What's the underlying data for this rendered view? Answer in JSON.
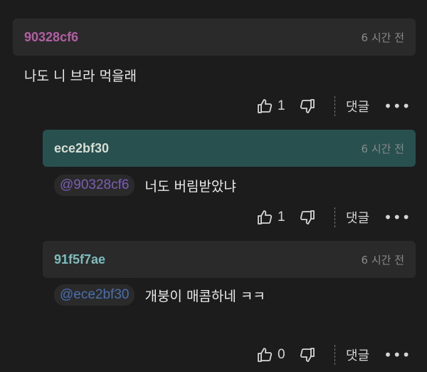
{
  "comments": [
    {
      "author": "90328cf6",
      "author_color": "#b35fa3",
      "time": "6 시간 전",
      "header_bg": "#2a2a2a",
      "text": "나도 니 브라 먹을래",
      "likes": "1"
    },
    {
      "author": "ece2bf30",
      "author_color": "#d7ded3",
      "time": "6 시간 전",
      "header_bg": "#27504f",
      "mention": "@90328cf6",
      "mention_color": "#7a5fb3",
      "text": "너도 버림받았냐",
      "likes": "1"
    },
    {
      "author": "91f5f7ae",
      "author_color": "#7fbdbd",
      "time": "6 시간 전",
      "header_bg": "#2a2a2a",
      "mention": "@ece2bf30",
      "mention_color": "#4a6fae",
      "text": "개붕이 매콤하네 ㅋㅋ",
      "likes": "0"
    }
  ],
  "reply_label": "댓글",
  "more_label": "•••",
  "icons": {
    "like": "thumbs-up-icon",
    "dislike": "thumbs-down-icon",
    "more": "more-dots-icon"
  }
}
